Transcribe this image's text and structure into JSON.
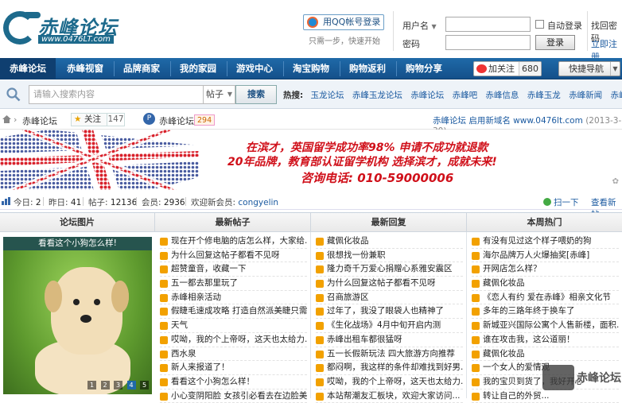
{
  "header": {
    "logo_text": "赤峰论坛",
    "logo_url": "www.0476LT.com",
    "qq_login": "用QQ帐号登录",
    "qq_hint": "只需一步，快速开始",
    "username_label": "用户名",
    "password_label": "密码",
    "auto_login": "自动登录",
    "login_button": "登录",
    "forgot_password": "找回密码",
    "register": "立即注册"
  },
  "nav": {
    "items": [
      "赤峰论坛",
      "赤峰视窗",
      "品牌商家",
      "我的家园",
      "游戏中心",
      "淘宝购物",
      "购物返利",
      "购物分享"
    ],
    "follow_label": "加关注",
    "follow_count": "680",
    "quick_nav": "快捷导航"
  },
  "search": {
    "placeholder": "请输入搜索内容",
    "type": "帖子",
    "button": "搜索",
    "hot_label": "热搜:",
    "hot_keywords": [
      "玉龙论坛",
      "赤峰玉龙论坛",
      "赤峰论坛",
      "赤峰吧",
      "赤峰信息",
      "赤峰玉龙",
      "赤峰新闻",
      "赤峰"
    ]
  },
  "crumb": {
    "forum": "赤峰论坛",
    "fav_label": "关注",
    "fav_count": "147",
    "channel": "赤峰论坛",
    "channel_count": "294",
    "notice": "赤峰论坛 启用新域名 www.0476lt.com",
    "notice_date": "(2013-3-30)"
  },
  "banner": {
    "line1": "在滨才，英国留学成功率98%  申请不成功就退款",
    "line2": "20年品牌，教育部认证留学机构 选择滨才，成就未来!",
    "line3": "咨询电话: 010-59000006"
  },
  "stats": {
    "today_label": "今日:",
    "today": "2",
    "yesterday_label": "昨日:",
    "yesterday": "41",
    "posts_label": "帖子:",
    "posts": "12136",
    "members_label": "会员:",
    "members": "2936",
    "welcome_label": "欢迎新会员:",
    "new_member": "congyelin",
    "scan": "扫一下",
    "view_all": "查看新帖"
  },
  "columns": {
    "pic_title": "论坛图片",
    "new_posts_title": "最新帖子",
    "new_replies_title": "最新回复",
    "hot_title": "本周热门",
    "pic_caption": "看看这个小狗怎么样!",
    "pic_pages": [
      "1",
      "2",
      "3",
      "4",
      "5"
    ],
    "new_posts": [
      "现在开个修电脑的店怎么样，大家给...",
      "为什么回复这帖子都看不见呀",
      "超赞童音，收藏一下",
      "五一都去那里玩了",
      "赤峰相亲活动",
      "假睫毛速成攻略 打造自然派美睫只需...",
      "天气",
      "哎呦，我的个上帝呀，这天也太给力...",
      "西水泉",
      "新人来报道了！",
      "看看这个小狗怎么样！",
      "小心变阴阳脸 女孩引必看去在边脸美容..."
    ],
    "new_replies": [
      "藏佩化妆品",
      "很想找一份兼职",
      "隆力奇千万爱心捐赠心系雅安震区",
      "为什么回复这帖子都看不见呀",
      "召商旅游区",
      "过年了，我没了眼袋人也精神了",
      "《生化战场》4月中旬开启内测",
      "赤峰出租车都很猛呀",
      "五一长假新玩法 四大旅游方向推荐",
      "都闷啊，我这样的条件却难找到好男...",
      "哎呦，我的个上帝呀，这天也太给力...",
      "本站帮潮友汇板块，欢迎大家访问..."
    ],
    "hot": [
      "有没有见过这个样子喂奶的狗",
      "海尔品牌万人火爆抽奖[赤峰]",
      "开网店怎么样？",
      "藏佩化妆品",
      "《恋人有约 爱在赤峰》相亲文化节",
      "多年的三路年终于换车了",
      "新城亚兴国际公寓个人售新楼，面积...",
      "谁在攻击我，这公道丽！",
      "藏佩化妆品",
      "一个女人的爱情观",
      "我的宝贝到货了，我好开心",
      "转让自己的外贸..."
    ]
  },
  "watermark": "赤峰论坛"
}
